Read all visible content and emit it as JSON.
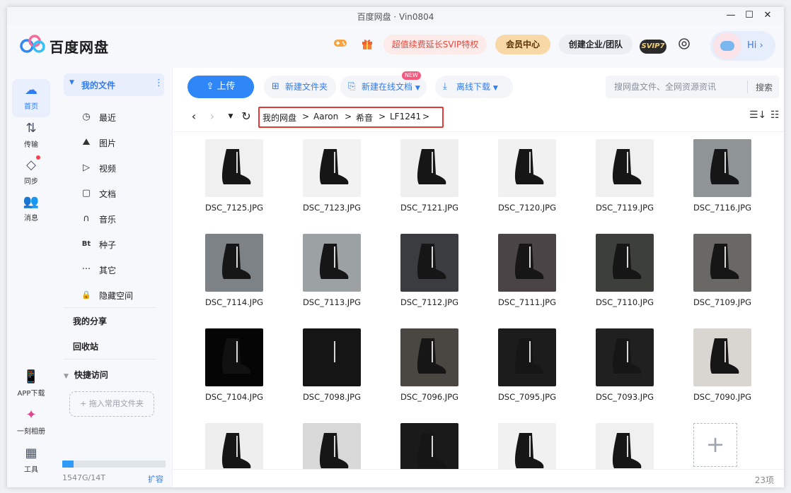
{
  "window": {
    "title": "百度网盘 · Vin0804",
    "minimize": "—",
    "maximize": "☐",
    "close": "✕"
  },
  "header": {
    "logo_text": "百度网盘",
    "promo": "超值续费延长SVIP特权",
    "vip_center": "会员中心",
    "enterprise": "创建企业/团队",
    "svip_badge": "SVIP7",
    "greeting": "Hi",
    "greeting_chevron": "›",
    "game_icon": "gamepad-icon",
    "gift_icon": "gift-icon",
    "settings_icon": "settings-icon"
  },
  "rail": [
    {
      "label": "首页",
      "icon": "☁"
    },
    {
      "label": "传输",
      "icon": "⇅"
    },
    {
      "label": "同步",
      "icon": "◇"
    },
    {
      "label": "消息",
      "icon": "👥"
    },
    {
      "label": "APP下载",
      "icon": "📱"
    },
    {
      "label": "一刻相册",
      "icon": "✦"
    },
    {
      "label": "工具",
      "icon": "▦"
    }
  ],
  "sidebar": {
    "my_files": "我的文件",
    "items": [
      {
        "label": "最近",
        "icon": "◷"
      },
      {
        "label": "图片",
        "icon": "⛰"
      },
      {
        "label": "视频",
        "icon": "▷"
      },
      {
        "label": "文档",
        "icon": "▢"
      },
      {
        "label": "音乐",
        "icon": "∩"
      },
      {
        "label": "种子",
        "icon": "Bt"
      },
      {
        "label": "其它",
        "icon": "···"
      },
      {
        "label": "隐藏空间",
        "icon": "🔒"
      }
    ],
    "my_share": "我的分享",
    "recycle": "回收站",
    "quick_access": "快捷访问",
    "drop_hint": "+ 拖入常用文件夹",
    "quota_text": "1547G/14T",
    "quota_fraction": 0.108,
    "expand": "扩容"
  },
  "toolbar": {
    "upload": "上传",
    "new_folder": "新建文件夹",
    "new_online_doc": "新建在线文档",
    "new_badge": "NEW",
    "offline_download": "离线下载",
    "search_placeholder": "搜网盘文件、全网资源资讯",
    "search_button": "搜索"
  },
  "breadcrumb": [
    "我的网盘",
    "Aaron",
    "希音",
    "LF1241"
  ],
  "breadcrumb_sep": ">",
  "files": [
    {
      "name": "DSC_7125.JPG",
      "tone": "#f0f0f0"
    },
    {
      "name": "DSC_7123.JPG",
      "tone": "#f2f2f2"
    },
    {
      "name": "DSC_7121.JPG",
      "tone": "#efefef"
    },
    {
      "name": "DSC_7120.JPG",
      "tone": "#f1f1f1"
    },
    {
      "name": "DSC_7119.JPG",
      "tone": "#f0f0f0"
    },
    {
      "name": "DSC_7116.JPG",
      "tone": "#8f9497"
    },
    {
      "name": "DSC_7114.JPG",
      "tone": "#7d8286"
    },
    {
      "name": "DSC_7113.JPG",
      "tone": "#9ca1a4"
    },
    {
      "name": "DSC_7112.JPG",
      "tone": "#3a3c40"
    },
    {
      "name": "DSC_7111.JPG",
      "tone": "#4b4446"
    },
    {
      "name": "DSC_7110.JPG",
      "tone": "#3d3f3a"
    },
    {
      "name": "DSC_7109.JPG",
      "tone": "#6a6865"
    },
    {
      "name": "DSC_7104.JPG",
      "tone": "#050505"
    },
    {
      "name": "DSC_7098.JPG",
      "tone": "#151515"
    },
    {
      "name": "DSC_7096.JPG",
      "tone": "#4a4642"
    },
    {
      "name": "DSC_7095.JPG",
      "tone": "#1c1c1c"
    },
    {
      "name": "DSC_7093.JPG",
      "tone": "#202020"
    },
    {
      "name": "DSC_7090.JPG",
      "tone": "#d9d6d2"
    },
    {
      "name": "",
      "tone": "#eeeeee"
    },
    {
      "name": "",
      "tone": "#d8d8d8"
    },
    {
      "name": "",
      "tone": "#1a1a1a"
    },
    {
      "name": "",
      "tone": "#f1f1f1"
    },
    {
      "name": "",
      "tone": "#f0f0f0"
    }
  ],
  "add_tile": "+",
  "item_count": "23项",
  "colors": {
    "accent": "#2f86f6",
    "breadcrumb_highlight": "#e53935",
    "promo": "#e8473d"
  }
}
